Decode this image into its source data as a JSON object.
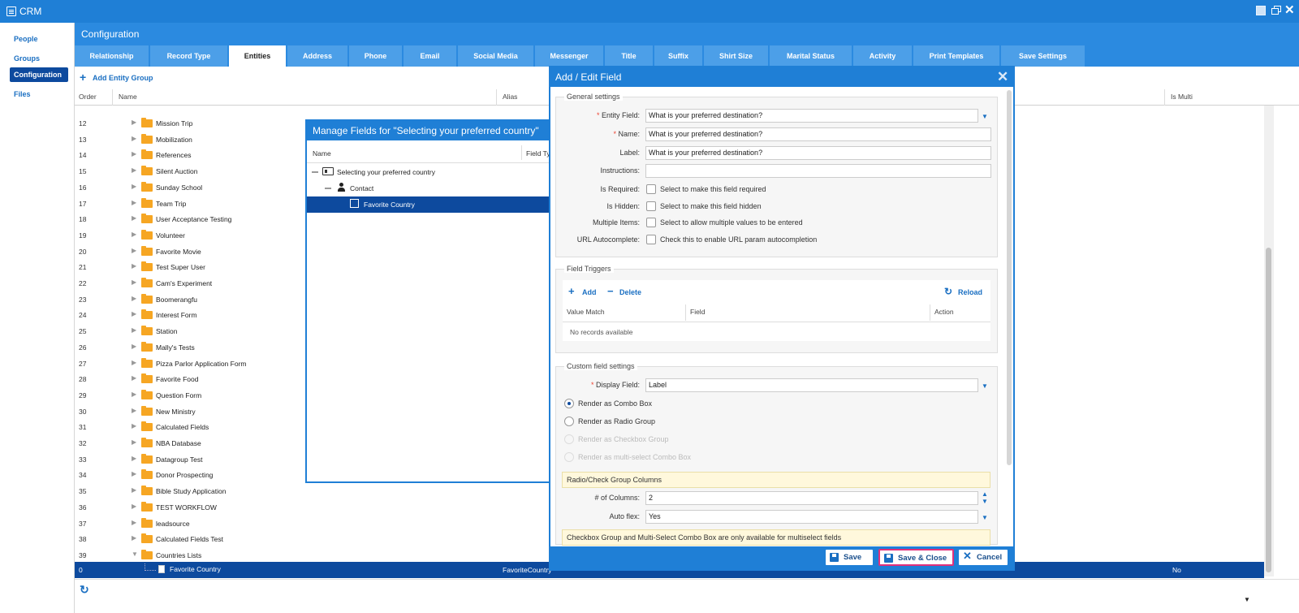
{
  "app": {
    "title": "CRM"
  },
  "sidebar": {
    "items": [
      {
        "label": "People"
      },
      {
        "label": "Groups"
      },
      {
        "label": "Configuration",
        "active": true
      },
      {
        "label": "Files"
      }
    ]
  },
  "config": {
    "title": "Configuration",
    "tabs": [
      {
        "label": "Relationship"
      },
      {
        "label": "Record Type"
      },
      {
        "label": "Entities",
        "active": true
      },
      {
        "label": "Address"
      },
      {
        "label": "Phone"
      },
      {
        "label": "Email"
      },
      {
        "label": "Social Media"
      },
      {
        "label": "Messenger"
      },
      {
        "label": "Title"
      },
      {
        "label": "Suffix"
      },
      {
        "label": "Shirt Size"
      },
      {
        "label": "Marital Status"
      },
      {
        "label": "Activity"
      },
      {
        "label": "Print Templates"
      },
      {
        "label": "Save Settings"
      }
    ]
  },
  "toolbar": {
    "add_group_label": "Add Entity Group"
  },
  "grid": {
    "columns": {
      "order": "Order",
      "name": "Name",
      "alias": "Alias",
      "is_multi": "Is Multi"
    },
    "rows": [
      {
        "order": "12",
        "name": "Mission Trip"
      },
      {
        "order": "13",
        "name": "Mobilization"
      },
      {
        "order": "14",
        "name": "References"
      },
      {
        "order": "15",
        "name": "Silent Auction"
      },
      {
        "order": "16",
        "name": "Sunday School"
      },
      {
        "order": "17",
        "name": "Team Trip"
      },
      {
        "order": "18",
        "name": "User Acceptance Testing"
      },
      {
        "order": "19",
        "name": "Volunteer"
      },
      {
        "order": "20",
        "name": "Favorite Movie"
      },
      {
        "order": "21",
        "name": "Test Super User"
      },
      {
        "order": "22",
        "name": "Cam's Experiment"
      },
      {
        "order": "23",
        "name": "Boomerangfu"
      },
      {
        "order": "24",
        "name": "Interest Form"
      },
      {
        "order": "25",
        "name": "Station"
      },
      {
        "order": "26",
        "name": "Mally's Tests"
      },
      {
        "order": "27",
        "name": "Pizza Parlor Application Form"
      },
      {
        "order": "28",
        "name": "Favorite Food"
      },
      {
        "order": "29",
        "name": "Question Form"
      },
      {
        "order": "30",
        "name": "New Ministry"
      },
      {
        "order": "31",
        "name": "Calculated Fields"
      },
      {
        "order": "32",
        "name": "NBA Database"
      },
      {
        "order": "33",
        "name": "Datagroup Test"
      },
      {
        "order": "34",
        "name": "Donor Prospecting"
      },
      {
        "order": "35",
        "name": "Bible Study Application"
      },
      {
        "order": "36",
        "name": "TEST WORKFLOW"
      },
      {
        "order": "37",
        "name": "leadsource"
      },
      {
        "order": "38",
        "name": "Calculated Fields Test"
      },
      {
        "order": "39",
        "name": "Countries Lists",
        "expanded": true
      }
    ],
    "selected_row": {
      "order": "0",
      "name": "Favorite Country",
      "alias": "FavoriteCountry",
      "is_multi": "No"
    }
  },
  "manage_window": {
    "title": "Manage Fields for \"Selecting your preferred country\"",
    "columns": {
      "name": "Name",
      "field_type": "Field Type"
    },
    "tree": [
      {
        "label": "Selecting your preferred country",
        "icon": "contact-card-icon"
      },
      {
        "label": "Contact",
        "icon": "person-icon"
      },
      {
        "label": "Favorite Country",
        "icon": "field-icon",
        "selected": true
      }
    ]
  },
  "edit_window": {
    "title": "Add / Edit Field",
    "general": {
      "legend": "General settings",
      "entity_field_label": "Entity Field:",
      "entity_field_value": "What is your preferred destination?",
      "name_label": "Name:",
      "name_value": "What is your preferred destination?",
      "label_label": "Label:",
      "label_value": "What is your preferred destination?",
      "instructions_label": "Instructions:",
      "instructions_value": "",
      "is_required_label": "Is Required:",
      "is_required_text": "Select to make this field required",
      "is_hidden_label": "Is Hidden:",
      "is_hidden_text": "Select to make this field hidden",
      "multiple_label": "Multiple Items:",
      "multiple_text": "Select to allow multiple values to be entered",
      "url_label": "URL Autocomplete:",
      "url_text": "Check this to enable URL param autocompletion"
    },
    "triggers": {
      "legend": "Field Triggers",
      "add": "Add",
      "delete": "Delete",
      "reload": "Reload",
      "columns": {
        "value_match": "Value Match",
        "field": "Field",
        "action": "Action"
      },
      "empty": "No records available"
    },
    "custom": {
      "legend": "Custom field settings",
      "display_field_label": "Display Field:",
      "display_field_value": "Label",
      "options": [
        {
          "label": "Render as Combo Box",
          "selected": true,
          "disabled": false
        },
        {
          "label": "Render as Radio Group",
          "selected": false,
          "disabled": false
        },
        {
          "label": "Render as Checkbox Group",
          "selected": false,
          "disabled": true
        },
        {
          "label": "Render as multi-select Combo Box",
          "selected": false,
          "disabled": true
        }
      ],
      "group_columns_banner": "Radio/Check Group Columns",
      "num_columns_label": "# of Columns:",
      "num_columns_value": "2",
      "auto_flex_label": "Auto flex:",
      "auto_flex_value": "Yes",
      "multiselect_note": "Checkbox Group and Multi-Select Combo Box are only available for multiselect fields"
    },
    "buttons": {
      "save": "Save",
      "save_close": "Save & Close",
      "cancel": "Cancel"
    }
  },
  "colors": {
    "header_blue": "#1f7fd6",
    "selected_navy": "#0d4a9e",
    "folder": "#f6a623",
    "highlight_pink": "#e0307c"
  }
}
